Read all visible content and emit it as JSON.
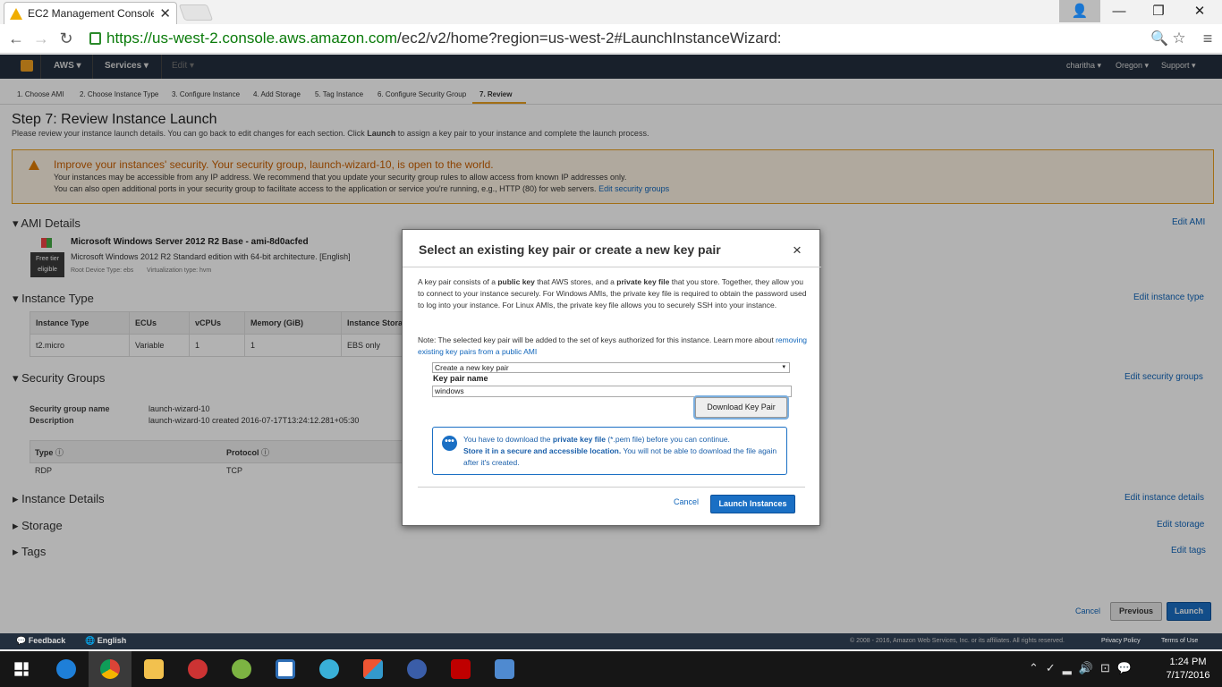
{
  "browser": {
    "tab_title": "EC2 Management Console",
    "url_host": "https://us-west-2.console.aws.amazon.com",
    "url_path": "/ec2/v2/home?region=us-west-2#LaunchInstanceWizard:"
  },
  "aws_header": {
    "aws": "AWS",
    "services": "Services",
    "edit": "Edit",
    "user": "charitha",
    "region": "Oregon",
    "support": "Support"
  },
  "steps": [
    "1. Choose AMI",
    "2. Choose Instance Type",
    "3. Configure Instance",
    "4. Add Storage",
    "5. Tag Instance",
    "6. Configure Security Group",
    "7. Review"
  ],
  "page": {
    "title": "Step 7: Review Instance Launch",
    "subtitle_pre": "Please review your instance launch details. You can go back to edit changes for each section. Click",
    "subtitle_bold": "Launch",
    "subtitle_post": "to assign a key pair to your instance and complete the launch process."
  },
  "warning": {
    "heading": "Improve your instances' security. Your security group, launch-wizard-10, is open to the world.",
    "line1": "Your instances may be accessible from any IP address. We recommend that you update your security group rules to allow access from known IP addresses only.",
    "line2": "You can also open additional ports in your security group to facilitate access to the application or service you're running, e.g., HTTP (80) for web servers.",
    "link": "Edit security groups"
  },
  "ami": {
    "section": "AMI Details",
    "edit": "Edit AMI",
    "name": "Microsoft Windows Server 2012 R2 Base - ami-8d0acfed",
    "desc": "Microsoft Windows 2012 R2 Standard edition with 64-bit architecture. [English]",
    "badge1": "Free tier",
    "badge2": "eligible",
    "root": "Root Device Type: ebs",
    "virt": "Virtualization type: hvm"
  },
  "instance_type": {
    "section": "Instance Type",
    "edit": "Edit instance type",
    "headers": [
      "Instance Type",
      "ECUs",
      "vCPUs",
      "Memory (GiB)",
      "Instance Stora"
    ],
    "row": [
      "t2.micro",
      "Variable",
      "1",
      "1",
      "EBS only"
    ]
  },
  "security_groups": {
    "section": "Security Groups",
    "edit": "Edit security groups",
    "name_label": "Security group name",
    "name_value": "launch-wizard-10",
    "desc_label": "Description",
    "desc_value": "launch-wizard-10 created 2016-07-17T13:24:12.281+05:30",
    "col_type": "Type",
    "col_protocol": "Protocol",
    "row_type": "RDP",
    "row_protocol": "TCP"
  },
  "collapsed": [
    {
      "label": "Instance Details",
      "edit": "Edit instance details"
    },
    {
      "label": "Storage",
      "edit": "Edit storage"
    },
    {
      "label": "Tags",
      "edit": "Edit tags"
    }
  ],
  "bottom_buttons": {
    "cancel": "Cancel",
    "previous": "Previous",
    "launch": "Launch"
  },
  "modal": {
    "title": "Select an existing key pair or create a new key pair",
    "close": "×",
    "p1_a": "A key pair consists of a",
    "p1_b": "public key",
    "p1_c": "that AWS stores, and a",
    "p1_d": "private key file",
    "p1_e": "that you store. Together, they allow you to connect to your instance securely. For Windows AMIs, the private key file is required to obtain the password used to log into your instance. For Linux AMIs, the private key file allows you to securely SSH into your instance.",
    "p2": "Note: The selected key pair will be added to the set of keys authorized for this instance. Learn more about",
    "p2_link": "removing existing key pairs from a public AMI",
    "select_value": "Create a new key pair",
    "kp_label": "Key pair name",
    "kp_value": "windows",
    "download": "Download Key Pair",
    "info_a": "You have to download the",
    "info_b": "private key file",
    "info_c": "(*.pem file) before you can continue.",
    "info_d": "Store it in a secure and accessible location.",
    "info_e": "You will not be able to download the file again after it's created.",
    "cancel": "Cancel",
    "launch": "Launch Instances"
  },
  "footer": {
    "feedback": "Feedback",
    "english": "English",
    "copyright": "© 2008 - 2016, Amazon Web Services, Inc. or its affiliates. All rights reserved.",
    "privacy": "Privacy Policy",
    "terms": "Terms of Use"
  },
  "clock": {
    "time": "1:24 PM",
    "date": "7/17/2016"
  }
}
